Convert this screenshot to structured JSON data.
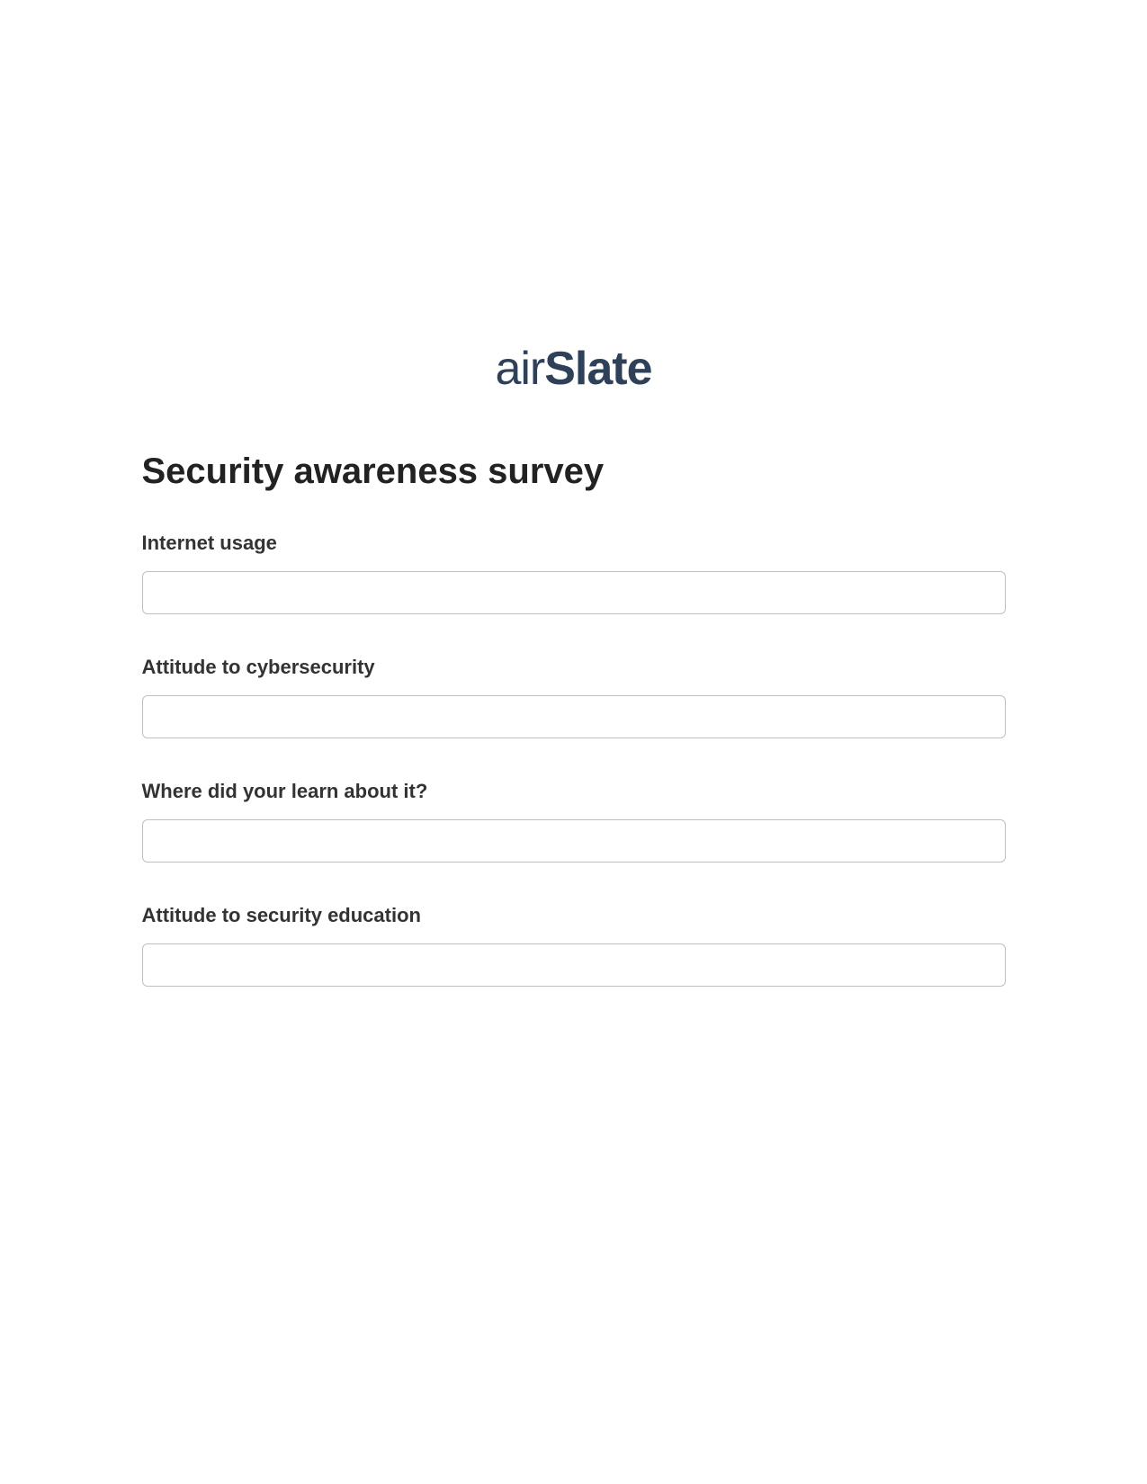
{
  "logo": {
    "part1": "air",
    "part2": "Slate"
  },
  "form": {
    "title": "Security awareness survey",
    "fields": [
      {
        "label": "Internet usage",
        "value": ""
      },
      {
        "label": "Attitude to cybersecurity",
        "value": ""
      },
      {
        "label": "Where did your learn about it?",
        "value": ""
      },
      {
        "label": "Attitude to security education",
        "value": ""
      }
    ]
  }
}
